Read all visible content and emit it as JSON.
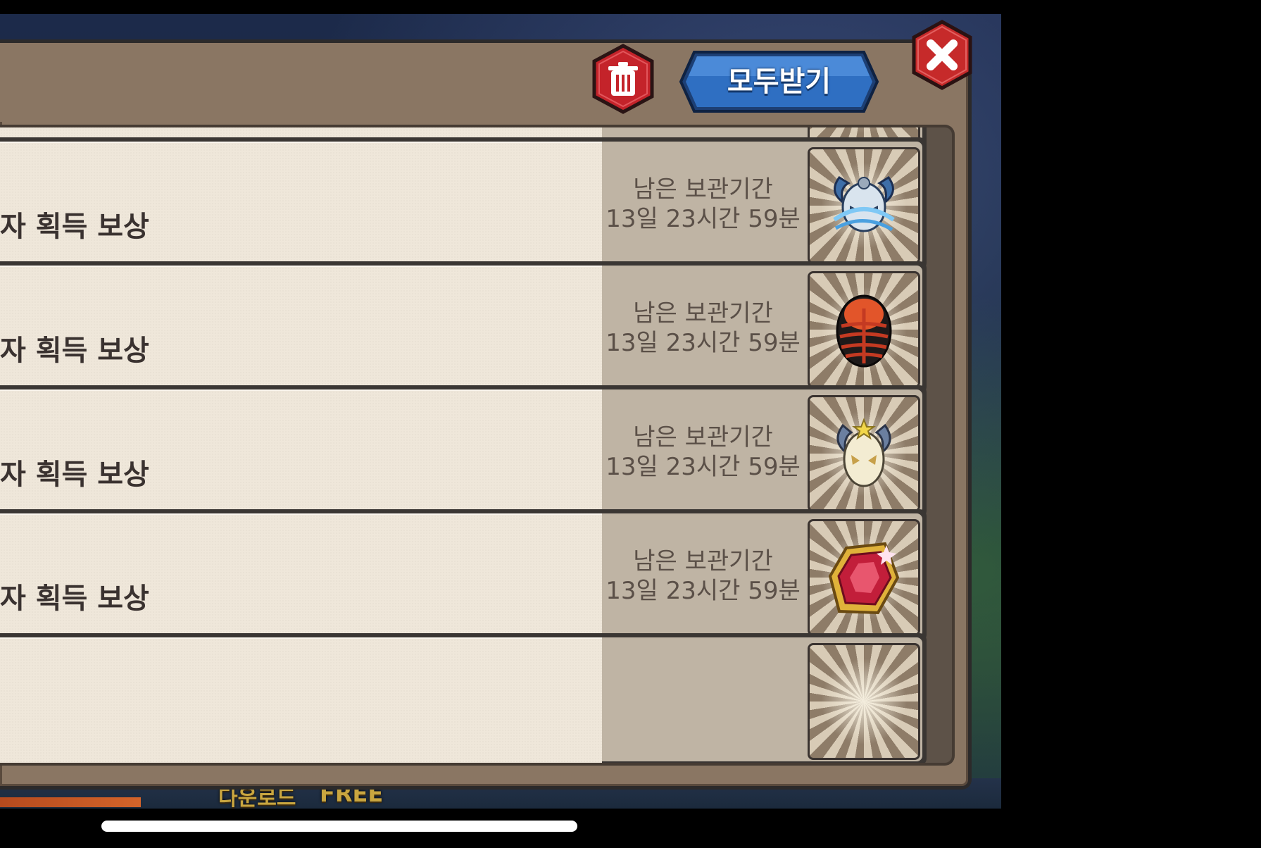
{
  "header": {
    "collect_all_label": "모두받기"
  },
  "mails": [
    {
      "title": "자 획득 보상",
      "expiry_label": "남은 보관기간",
      "expiry_time": "13일 23시간 59분",
      "reward_icon": "horned-mask-chained-icon"
    },
    {
      "title": "자 획득 보상",
      "expiry_label": "남은 보관기간",
      "expiry_time": "13일 23시간 59분",
      "reward_icon": "red-black-egg-icon"
    },
    {
      "title": "자 획득 보상",
      "expiry_label": "남은 보관기간",
      "expiry_time": "13일 23시간 59분",
      "reward_icon": "white-horned-mask-icon"
    },
    {
      "title": "자 획득 보상",
      "expiry_label": "남은 보관기간",
      "expiry_time": "13일 23시간 59분",
      "reward_icon": "red-gem-icon"
    }
  ],
  "background": {
    "banner_download": "다운로드",
    "banner_free": "FREE"
  },
  "colors": {
    "dialog": "#8a7663",
    "mail_body": "#efe7da",
    "mail_side": "#bfb4a4",
    "collect_button": "#2f6fc2",
    "trash_button": "#c4232a",
    "close_button": "#c62a2a"
  }
}
